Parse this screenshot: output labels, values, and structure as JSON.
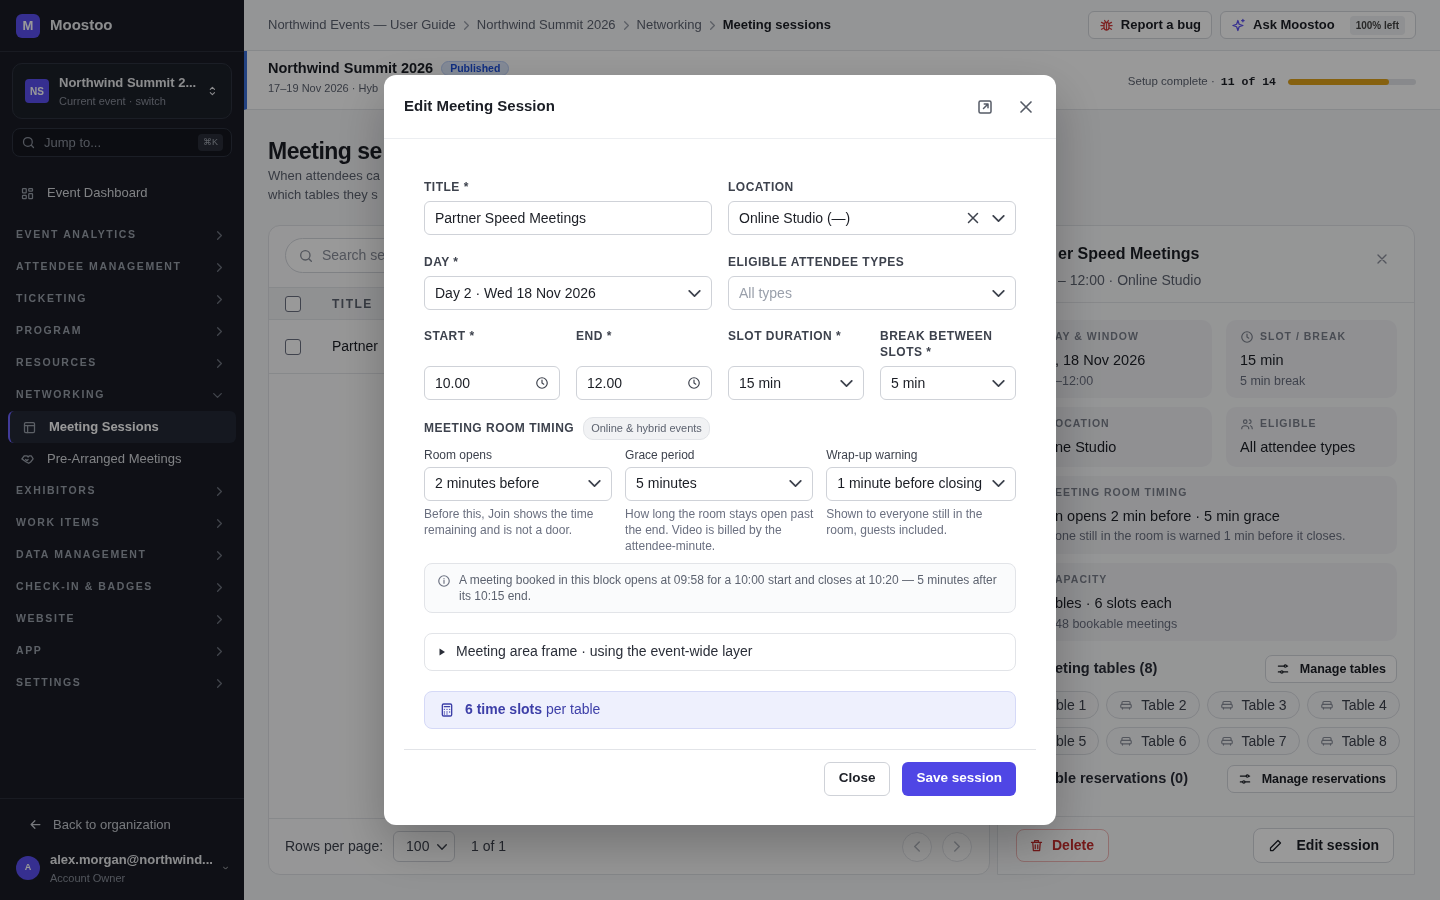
{
  "app": {
    "logo_letter": "M",
    "name": "Moostoo"
  },
  "event_switcher": {
    "initials": "NS",
    "name": "Northwind Summit 2...",
    "caption": "Current event · switch"
  },
  "jump": {
    "placeholder": "Jump to...",
    "shortcut": "⌘K"
  },
  "sidebar": {
    "items": [
      {
        "kind": "link",
        "label": "Event Dashboard",
        "selected": false
      },
      {
        "kind": "section",
        "label": "EVENT ANALYTICS",
        "expanded": false
      },
      {
        "kind": "section",
        "label": "ATTENDEE MANAGEMENT",
        "expanded": false
      },
      {
        "kind": "section",
        "label": "TICKETING",
        "expanded": false
      },
      {
        "kind": "section",
        "label": "PROGRAM",
        "expanded": false
      },
      {
        "kind": "section",
        "label": "RESOURCES",
        "expanded": false
      },
      {
        "kind": "section",
        "label": "NETWORKING",
        "expanded": true,
        "children": [
          {
            "kind": "sessions",
            "label": "Meeting Sessions",
            "selected": true
          },
          {
            "kind": "prearranged",
            "label": "Pre-Arranged Meetings",
            "selected": false
          }
        ]
      },
      {
        "kind": "section",
        "label": "EXHIBITORS",
        "expanded": false
      },
      {
        "kind": "section",
        "label": "WORK ITEMS",
        "expanded": false
      },
      {
        "kind": "section",
        "label": "DATA MANAGEMENT",
        "expanded": false
      },
      {
        "kind": "section",
        "label": "CHECK-IN & BADGES",
        "expanded": false
      },
      {
        "kind": "section",
        "label": "WEBSITE",
        "expanded": false
      },
      {
        "kind": "section",
        "label": "APP",
        "expanded": false
      },
      {
        "kind": "section",
        "label": "SETTINGS",
        "expanded": false
      }
    ]
  },
  "back_link": "Back to organization",
  "user": {
    "initial": "A",
    "email": "alex.morgan@northwind...",
    "role": "Account Owner"
  },
  "breadcrumbs": [
    "Northwind Events — User Guide",
    "Northwind Summit 2026",
    "Networking",
    "Meeting sessions"
  ],
  "top_actions": [
    {
      "kind": "bug",
      "label": "Report a bug"
    },
    {
      "kind": "assistant",
      "label": "Ask Moostoo",
      "badge": "100% left"
    }
  ],
  "event_header": {
    "title": "Northwind Summit 2026",
    "status": "Published",
    "meta": "17–19 Nov 2026 · Hyb",
    "setup_label": "Setup complete ·",
    "setup_count": "11 of 14",
    "level": 0.786
  },
  "page": {
    "title": "Meeting se",
    "description_lines": [
      "When attendees ca",
      "which tables they s"
    ]
  },
  "table": {
    "search_placeholder": "Search se",
    "columns": [
      "TITLE"
    ],
    "header_checked": false,
    "rows": [
      {
        "title": "Partner",
        "checked": false
      }
    ],
    "rows_per_page_label": "Rows per page:",
    "rows_per_page": "100",
    "page_info": "1 of 1",
    "previous_disabled": true,
    "next_disabled": true
  },
  "detail": {
    "title": "er Speed Meetings",
    "subtitle": "– 12:00 · Online Studio",
    "cards": [
      {
        "kind": "plain",
        "label": "AY & WINDOW",
        "value": ", 18 Nov 2026",
        "note": "–12:00"
      },
      {
        "kind": "clock",
        "label": "SLOT / BREAK",
        "value": "15 min",
        "note": "5 min break"
      },
      {
        "kind": "plain",
        "label": "OCATION",
        "value": "ne Studio"
      },
      {
        "kind": "people",
        "label": "ELIGIBLE",
        "value": "All attendee types"
      },
      {
        "kind": "wide",
        "label": "EETING ROOM TIMING",
        "value": "n opens 2 min before · 5 min grace",
        "note": "one still in the room is warned 1 min before it closes."
      },
      {
        "kind": "wide",
        "label": "APACITY",
        "value": "bles · 6 slots each",
        "note": "48 bookable meetings"
      }
    ],
    "tables_heading": "eting tables (8)",
    "manage_tables": "Manage tables",
    "tables": [
      "ble 1",
      "Table 2",
      "Table 3",
      "Table 4",
      "ble 5",
      "Table 6",
      "Table 7",
      "Table 8"
    ],
    "reservations_heading": "ble reservations (0)",
    "manage_reservations": "Manage reservations",
    "delete": "Delete",
    "edit": "Edit session"
  },
  "modal": {
    "title": "Edit Meeting Session",
    "fields": [
      {
        "kind": "text",
        "label": "TITLE *",
        "value": "Partner Speed Meetings"
      },
      {
        "kind": "select",
        "label": "LOCATION",
        "value": "Online Studio (—)",
        "clearable": true
      },
      {
        "kind": "select",
        "label": "DAY *",
        "value": "Day 2 · Wed 18 Nov 2026",
        "clearable": false
      },
      {
        "kind": "select",
        "label": "ELIGIBLE ATTENDEE TYPES",
        "placeholder": "All types",
        "clearable": false
      }
    ],
    "timing_fields": [
      {
        "kind": "time",
        "label": "START *",
        "value": "10.00"
      },
      {
        "kind": "time",
        "label": "END *",
        "value": "12.00"
      },
      {
        "kind": "select",
        "label": "SLOT DURATION *",
        "value": "15 min"
      },
      {
        "kind": "select",
        "label": "BREAK BETWEEN SLOTS *",
        "value": "5 min"
      }
    ],
    "room_timing": {
      "heading": "MEETING ROOM TIMING",
      "badge": "Online & hybrid events",
      "fields": [
        {
          "label": "Room opens",
          "value": "2 minutes before",
          "help": "Before this, Join shows the time remaining and is not a door."
        },
        {
          "label": "Grace period",
          "value": "5 minutes",
          "help": "How long the room stays open past the end. Video is billed by the attendee-minute."
        },
        {
          "label": "Wrap-up warning",
          "value": "1 minute before closing",
          "help": "Shown to everyone still in the room, guests included."
        }
      ]
    },
    "info": "A meeting booked in this block opens at 09:58 for a 10:00 start and closes at 10:20 — 5 minutes after its 10:15 end.",
    "frame": {
      "label": "Meeting area frame · using the event-wide layer",
      "expanded": false
    },
    "summary": "**6 time slots** per table",
    "buttons": [
      {
        "kind": "secondary",
        "label": "Close"
      },
      {
        "kind": "primary",
        "label": "Save session"
      }
    ]
  }
}
